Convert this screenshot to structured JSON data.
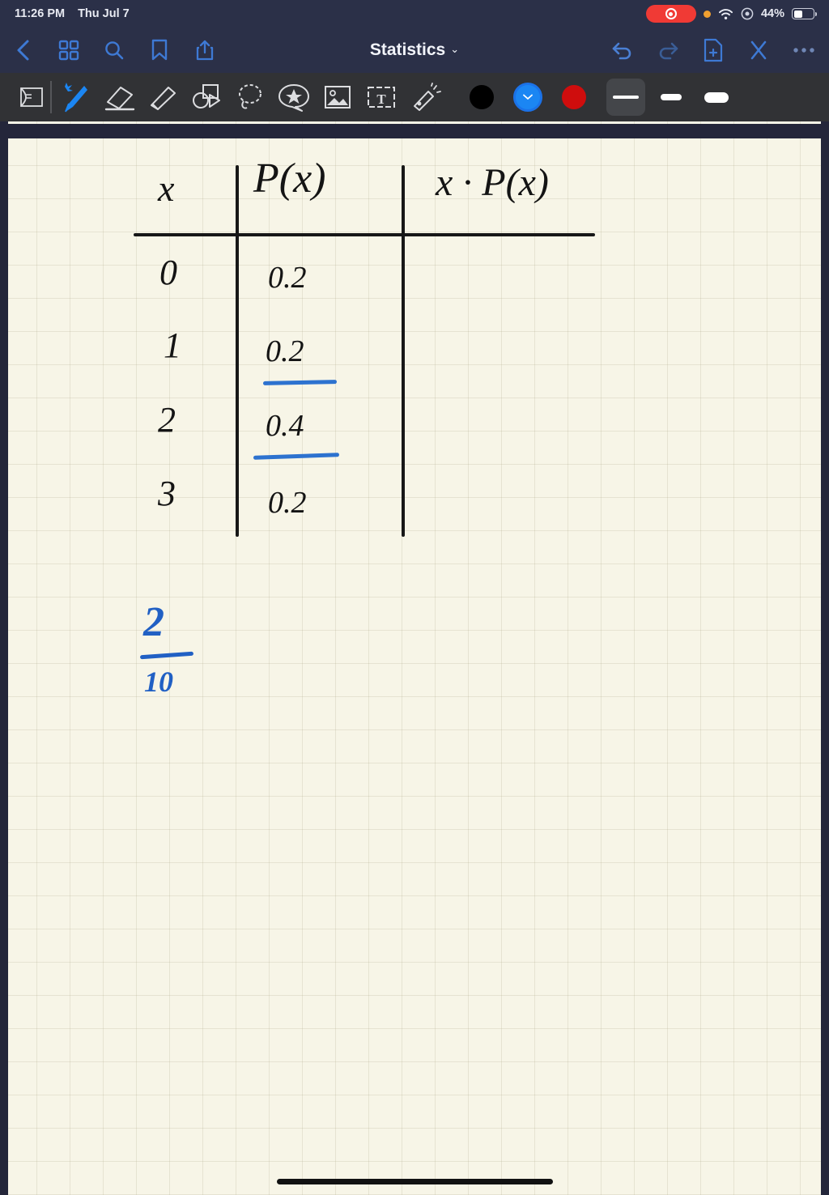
{
  "status_bar": {
    "time": "11:26 PM",
    "date": "Thu Jul 7",
    "battery_percent": "44%",
    "icons": [
      "screen-recording-pill",
      "orange-privacy-dot",
      "wifi-icon",
      "location-icon",
      "battery-icon"
    ]
  },
  "nav_bar": {
    "title": "Statistics",
    "title_chevron": "⌄",
    "left_icons": [
      {
        "name": "back-button",
        "glyph": "‹"
      },
      {
        "name": "thumbnails-grid-icon",
        "glyph": "grid"
      },
      {
        "name": "search-icon",
        "glyph": "search"
      },
      {
        "name": "bookmark-icon",
        "glyph": "bookmark"
      },
      {
        "name": "share-icon",
        "glyph": "share"
      }
    ],
    "right_icons": [
      {
        "name": "undo-icon",
        "glyph": "undo"
      },
      {
        "name": "redo-icon",
        "glyph": "redo"
      },
      {
        "name": "new-page-icon",
        "glyph": "page-plus"
      },
      {
        "name": "close-icon",
        "glyph": "x"
      },
      {
        "name": "more-options-icon",
        "glyph": "•••"
      }
    ]
  },
  "toolbar": {
    "tools": [
      {
        "name": "page-flip-tool",
        "label": "Page flip"
      },
      {
        "name": "pen-tool",
        "label": "Pen",
        "selected": true,
        "bluetooth": true
      },
      {
        "name": "eraser-tool",
        "label": "Eraser"
      },
      {
        "name": "highlighter-tool",
        "label": "Highlighter"
      },
      {
        "name": "shapes-tool",
        "label": "Shapes"
      },
      {
        "name": "lasso-tool",
        "label": "Lasso"
      },
      {
        "name": "sticker-tool",
        "label": "Sticker"
      },
      {
        "name": "image-tool",
        "label": "Image"
      },
      {
        "name": "text-box-tool",
        "label": "Text box"
      },
      {
        "name": "laser-pointer-tool",
        "label": "Laser pointer"
      }
    ],
    "colors": [
      {
        "name": "color-swatch-black",
        "hex": "#000000",
        "selected": false
      },
      {
        "name": "color-swatch-blue",
        "hex": "#1b86f3",
        "selected": true
      },
      {
        "name": "color-swatch-red",
        "hex": "#cf0d0d",
        "selected": false
      }
    ],
    "stroke_widths": [
      {
        "name": "stroke-width-thin",
        "selected": true
      },
      {
        "name": "stroke-width-medium",
        "selected": false
      },
      {
        "name": "stroke-width-thick",
        "selected": false
      }
    ]
  },
  "note": {
    "table": {
      "headers": [
        "x",
        "P(x)",
        "x · P(x)"
      ],
      "rows": [
        {
          "x": "0",
          "px": "0.2",
          "xpx": "",
          "underline": false
        },
        {
          "x": "1",
          "px": "0.2",
          "xpx": "",
          "underline": true
        },
        {
          "x": "2",
          "px": "0.4",
          "xpx": "",
          "underline": true
        },
        {
          "x": "3",
          "px": "0.2",
          "xpx": "",
          "underline": false
        }
      ]
    },
    "fraction": {
      "numerator": "2",
      "denominator": "10",
      "color": "#2160c4"
    },
    "ink_colors": {
      "black": "#141414",
      "blue": "#2d72cf"
    }
  }
}
